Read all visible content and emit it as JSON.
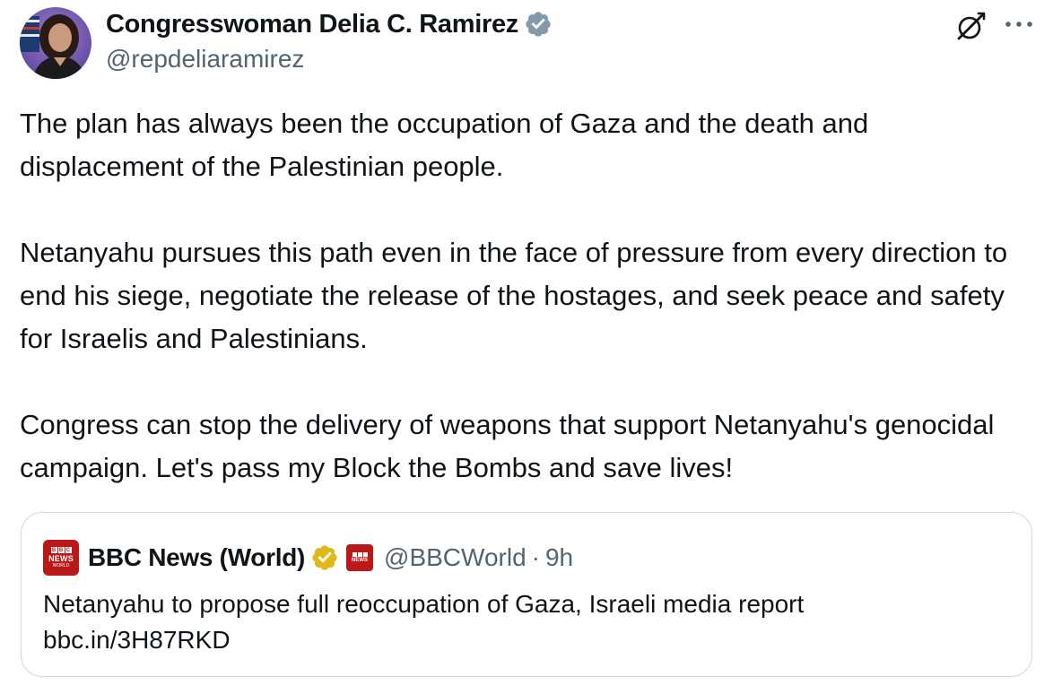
{
  "author": {
    "name": "Congresswoman Delia C. Ramirez",
    "handle": "@repdeliaramirez",
    "avatar_icon": "avatar-photo",
    "verified_icon": "verified-badge-icon",
    "verified_color": "#829aab"
  },
  "actions": {
    "grok_icon": "grok-icon",
    "more_icon": "more-icon"
  },
  "tweet": {
    "paragraphs": [
      "The plan has always been the occupation of Gaza and the death and displacement of the Palestinian people.",
      "Netanyahu pursues this path even in the face of pressure from every direction to end his siege, negotiate the release of the hostages, and seek peace and safety for Israelis and Palestinians.",
      "Congress can stop the delivery of weapons that support Netanyahu's genocidal campaign. Let's pass my Block the Bombs and save lives!"
    ]
  },
  "quote": {
    "logo": {
      "letters": [
        "B",
        "B",
        "C"
      ],
      "news": "NEWS",
      "world": "WORLD"
    },
    "name": "BBC News (World)",
    "badge_icon": "gold-verified-badge-icon",
    "badge_color": "#e2b719",
    "affiliate_icon": "bbc-affiliate-icon",
    "handle": "@BBCWorld",
    "separator": "·",
    "time": "9h",
    "text": "Netanyahu to propose full reoccupation of Gaza, Israeli media report",
    "link": "bbc.in/3H87RKD"
  },
  "colors": {
    "text": "#0f1419",
    "secondary": "#536471",
    "border": "#cfd9de",
    "bbc_red": "#bb1919"
  }
}
